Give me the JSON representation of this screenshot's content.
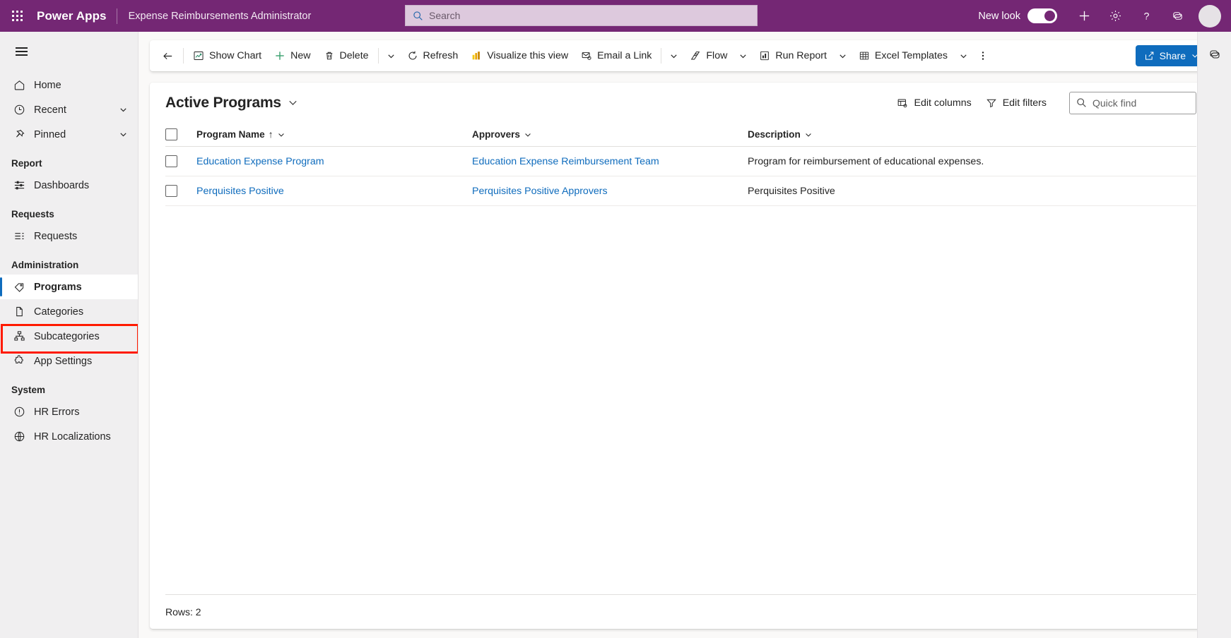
{
  "header": {
    "waffle_label": "app-launcher",
    "brand": "Power Apps",
    "app_name": "Expense Reimbursements Administrator",
    "search": {
      "value": "",
      "placeholder": "Search"
    },
    "new_look_label": "New look",
    "new_look_on": true,
    "icons": [
      "waffle-icon",
      "search-icon",
      "plus-icon",
      "gear-icon",
      "help-icon",
      "copilot-icon",
      "avatar"
    ],
    "colors": {
      "bar": "#742774",
      "search_bg": "#ddc9dd"
    }
  },
  "sidebar": {
    "collapse_label": "hamburger-icon",
    "items": [
      {
        "label": "Home",
        "icon": "home-icon",
        "expandable": false,
        "selected": false
      },
      {
        "label": "Recent",
        "icon": "clock-icon",
        "expandable": true,
        "selected": false
      },
      {
        "label": "Pinned",
        "icon": "pin-icon",
        "expandable": true,
        "selected": false
      }
    ],
    "groups": [
      {
        "title": "Report",
        "items": [
          {
            "label": "Dashboards",
            "icon": "dashboard-icon",
            "selected": false
          }
        ]
      },
      {
        "title": "Requests",
        "items": [
          {
            "label": "Requests",
            "icon": "list-icon",
            "selected": false
          }
        ]
      },
      {
        "title": "Administration",
        "items": [
          {
            "label": "Programs",
            "icon": "tag-icon",
            "selected": true,
            "highlighted": true
          },
          {
            "label": "Categories",
            "icon": "document-icon",
            "selected": false
          },
          {
            "label": "Subcategories",
            "icon": "hierarchy-icon",
            "selected": false
          },
          {
            "label": "App Settings",
            "icon": "puzzle-icon",
            "selected": false
          }
        ]
      },
      {
        "title": "System",
        "items": [
          {
            "label": "HR Errors",
            "icon": "error-circle-icon",
            "selected": false
          },
          {
            "label": "HR Localizations",
            "icon": "globe-icon",
            "selected": false
          }
        ]
      }
    ],
    "highlight_color": "#ff1a00"
  },
  "command_bar": {
    "back_label": "back-arrow-icon",
    "buttons": [
      {
        "label": "Show Chart",
        "icon": "chart-icon"
      },
      {
        "label": "New",
        "icon": "plus-icon"
      },
      {
        "label": "Delete",
        "icon": "trash-icon"
      },
      {
        "label": "Refresh",
        "icon": "refresh-icon"
      },
      {
        "label": "Visualize this view",
        "icon": "powerbi-icon"
      },
      {
        "label": "Email a Link",
        "icon": "email-icon"
      },
      {
        "label": "Flow",
        "icon": "flow-icon"
      },
      {
        "label": "Run Report",
        "icon": "report-icon"
      },
      {
        "label": "Excel Templates",
        "icon": "excel-icon"
      }
    ],
    "overflow_label": "more-options-icon",
    "share": {
      "label": "Share",
      "icon": "share-icon",
      "color": "#0f6cbd"
    }
  },
  "view": {
    "title": "Active Programs",
    "edit_columns": "Edit columns",
    "edit_filters": "Edit filters",
    "quick_find": {
      "value": "",
      "placeholder": "Quick find"
    }
  },
  "table": {
    "columns": [
      {
        "label": "Program Name",
        "sorted": "asc",
        "sort_glyph": "↑"
      },
      {
        "label": "Approvers",
        "sorted": "",
        "sort_glyph": ""
      },
      {
        "label": "Description",
        "sorted": "",
        "sort_glyph": ""
      }
    ],
    "rows": [
      {
        "name": "Education Expense Program",
        "approvers": "Education Expense Reimbursement Team",
        "description": "Program for reimbursement of educational expenses."
      },
      {
        "name": "Perquisites Positive",
        "approvers": "Perquisites Positive Approvers",
        "description": "Perquisites Positive"
      }
    ],
    "footer": "Rows: 2",
    "link_color": "#0f6cbd"
  },
  "right_rail": {
    "copilot_label": "copilot-icon"
  }
}
